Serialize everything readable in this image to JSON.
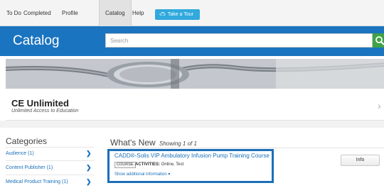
{
  "nav": {
    "items": [
      "To Do",
      "Completed",
      "Profile",
      "Catalog",
      "Help"
    ],
    "active": "Catalog",
    "tour_label": "Take a Tour"
  },
  "catalog": {
    "title": "Catalog",
    "search_placeholder": "Search"
  },
  "program": {
    "title": "CE Unlimited",
    "subtitle": "Unlimited Access to Education"
  },
  "sidebar": {
    "heading": "Categories",
    "items": [
      {
        "label": "Audience (1)"
      },
      {
        "label": "Content Publisher (1)"
      },
      {
        "label": "Medical Product Training (1)"
      }
    ]
  },
  "main": {
    "heading": "What's New",
    "showing": "Showing 1 of 1",
    "course": {
      "title": "CADD®-Solis VIP Ambulatory Infusion Pump Training Course",
      "badge": "COURSE",
      "activities_label": "ACTIVITIES:",
      "activities_value": "Online, Test",
      "show_more": "Show additional information ▾",
      "info_label": "Info"
    }
  },
  "colors": {
    "brand_blue": "#1b74bf",
    "tour_blue": "#31a9dd",
    "search_green": "#3fa246"
  }
}
